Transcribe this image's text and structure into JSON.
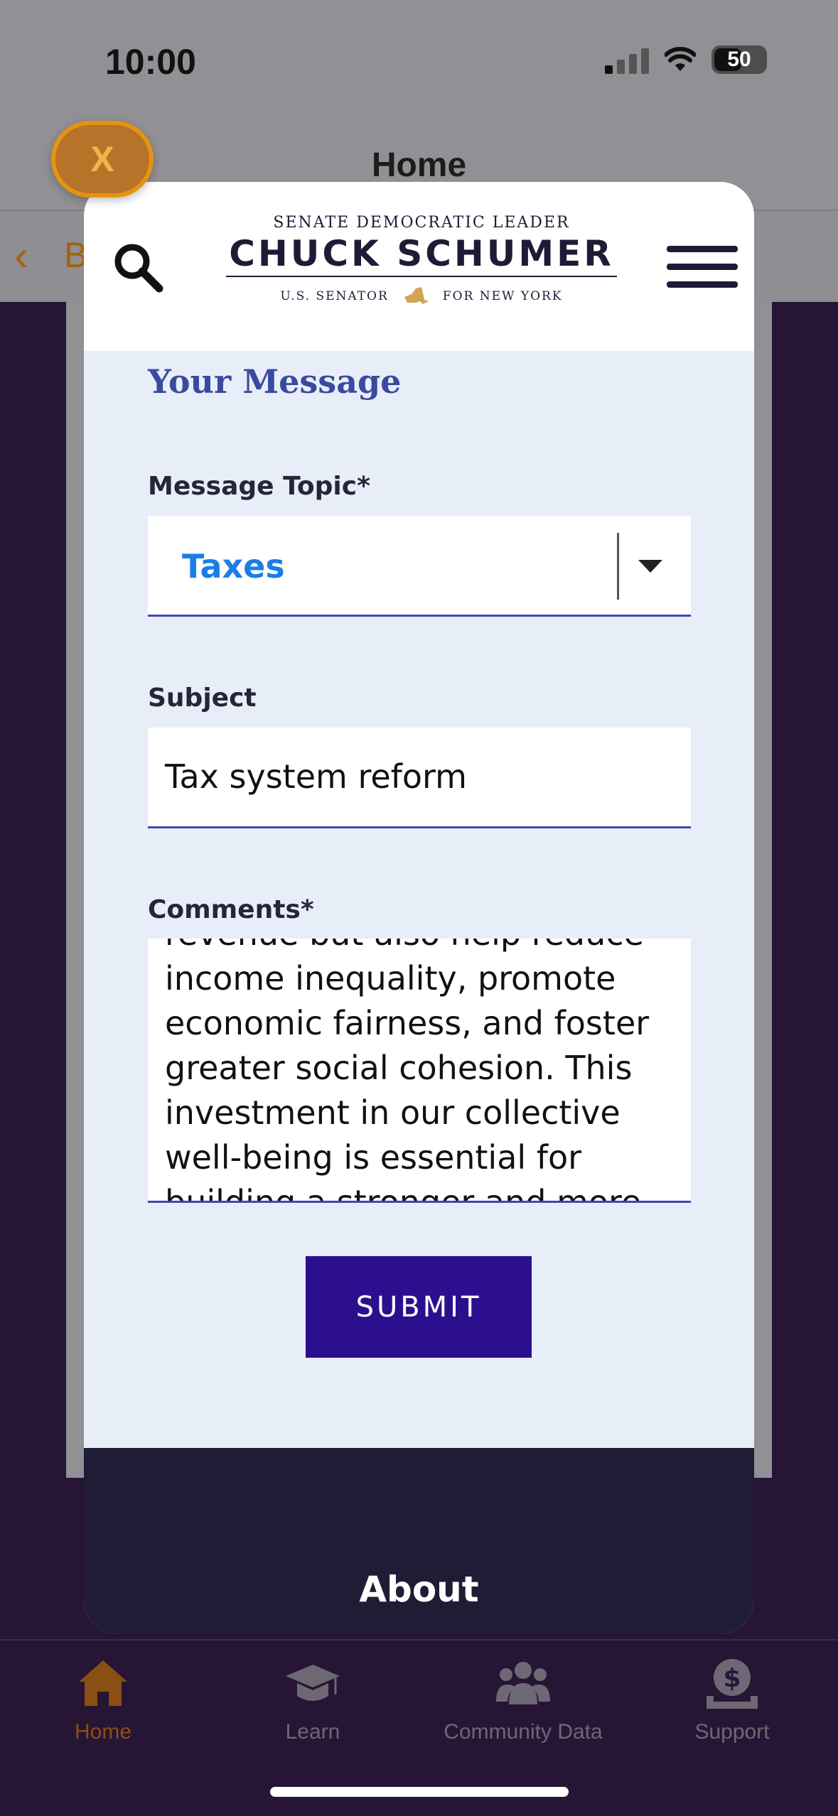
{
  "status_bar": {
    "time": "10:00",
    "battery": "50"
  },
  "app": {
    "title": "Home",
    "back_label": "B"
  },
  "overlay": {
    "close_label": "X"
  },
  "logo": {
    "top": "SENATE DEMOCRATIC LEADER",
    "name": "CHUCK SCHUMER",
    "left": "U.S. SENATOR",
    "right": "FOR NEW YORK"
  },
  "form": {
    "section_title": "Your Message",
    "topic_label": "Message Topic*",
    "topic_value": "Taxes",
    "subject_label": "Subject",
    "subject_value": "Tax system reform",
    "comments_label": "Comments*",
    "comments_value": "revenue but also help reduce income inequality, promote economic fairness, and foster greater social cohesion. This investment in our collective well-being is essential for building a stronger and more",
    "submit_label": "SUBMIT"
  },
  "footer": {
    "about_label": "About"
  },
  "tabbar": {
    "items": [
      {
        "label": "Home",
        "icon": "home-icon",
        "active": true
      },
      {
        "label": "Learn",
        "icon": "graduation-cap-icon",
        "active": false
      },
      {
        "label": "Community Data",
        "icon": "users-icon",
        "active": false
      },
      {
        "label": "Support",
        "icon": "donate-icon",
        "active": false
      }
    ]
  },
  "colors": {
    "accent": "#e59312",
    "link_blue": "#1a7ee6",
    "submit": "#2c0f8f",
    "footer": "#201c36",
    "title_blue": "#3a4a9e"
  }
}
